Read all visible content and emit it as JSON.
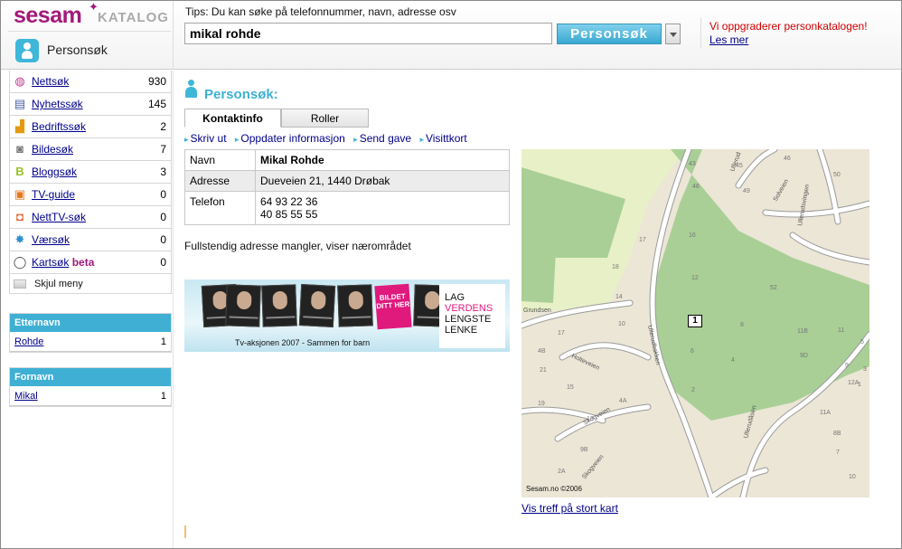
{
  "header": {
    "logo": {
      "brand": "sesam",
      "product": "KATALOG"
    },
    "vertical_label": "Personsøk",
    "tips": "Tips: Du kan søke på telefonnummer, navn, adresse osv",
    "search_value": "mikal rohde",
    "search_button_label": "Personsøk",
    "notice_text": "Vi oppgraderer personkatalogen!",
    "notice_link": "Les mer"
  },
  "nav": {
    "items": [
      {
        "label": "Nettsøk",
        "count": "930",
        "icon": "globe-icon"
      },
      {
        "label": "Nyhetssøk",
        "count": "145",
        "icon": "newspaper-icon"
      },
      {
        "label": "Bedriftssøk",
        "count": "2",
        "icon": "factory-icon"
      },
      {
        "label": "Bildesøk",
        "count": "7",
        "icon": "camera-icon"
      },
      {
        "label": "Bloggsøk",
        "count": "3",
        "icon": "blog-icon"
      },
      {
        "label": "TV-guide",
        "count": "0",
        "icon": "tv-icon"
      },
      {
        "label": "NettTV-søk",
        "count": "0",
        "icon": "video-camera-icon"
      },
      {
        "label": "Værsøk",
        "count": "0",
        "icon": "weather-icon"
      },
      {
        "label": "Kartsøk",
        "count": "0",
        "icon": "map-ring-icon",
        "badge": "beta"
      }
    ],
    "hide_menu_label": "Skjul meny"
  },
  "facets": [
    {
      "title": "Etternavn",
      "rows": [
        {
          "label": "Rohde",
          "count": "1"
        }
      ]
    },
    {
      "title": "Fornavn",
      "rows": [
        {
          "label": "Mikal",
          "count": "1"
        }
      ]
    }
  ],
  "main": {
    "title": "Personsøk:",
    "tabs": [
      {
        "label": "Kontaktinfo"
      },
      {
        "label": "Roller"
      }
    ],
    "actions": [
      "Skriv ut",
      "Oppdater informasjon",
      "Send gave",
      "Visittkort"
    ],
    "info": {
      "name_label": "Navn",
      "name_value": "Mikal Rohde",
      "address_label": "Adresse",
      "address_value": "Dueveien 21, 1440 Drøbak",
      "phone_label": "Telefon",
      "phones": [
        "64 93 22 36",
        "40 85 55 55"
      ]
    },
    "note": "Fullstendig adresse mangler, viser nærområdet",
    "banner": {
      "slogan": "Tv-aksjonen 2007 - Sammen for barn",
      "pink_label": "BILDET DITT HER",
      "lines": [
        "LAG",
        "VERDENS",
        "LENGSTE",
        "LENKE"
      ]
    }
  },
  "map": {
    "marker_label": "1",
    "credit": "Sesam.no ©2006",
    "street_labels": [
      "Ullerudbakken",
      "Ullerudåsen",
      "Holteveien",
      "Skogveien",
      "Ullerudsvingen",
      "Solveien",
      "Grundsen",
      "Ullerud",
      "Skogveien"
    ],
    "house_numbers": [
      "43",
      "45",
      "46",
      "48",
      "49",
      "50",
      "52",
      "17",
      "18",
      "16",
      "14",
      "12",
      "10",
      "8",
      "4",
      "6",
      "2",
      "11B",
      "11",
      "9D",
      "9",
      "11A",
      "8B",
      "7",
      "5",
      "3",
      "1",
      "4B",
      "12A",
      "19",
      "15",
      "13",
      "9B",
      "4A",
      "2A",
      "10",
      "21",
      "17"
    ],
    "link": "Vis treff på stort kart"
  }
}
